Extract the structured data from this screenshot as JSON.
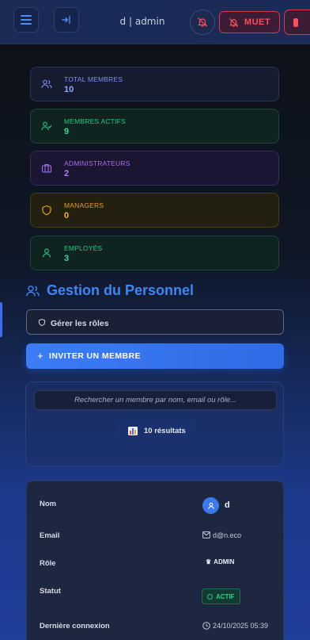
{
  "header": {
    "user_label": "d | admin",
    "mute_label": "MUET"
  },
  "stats": [
    {
      "label": "TOTAL MEMBRES",
      "value": "10",
      "icon": "users-icon",
      "color": "#7b8ef0"
    },
    {
      "label": "MEMBRES ACTIFS",
      "value": "9",
      "icon": "user-check-icon",
      "color": "#27c58c"
    },
    {
      "label": "ADMINISTRATEURS",
      "value": "2",
      "icon": "briefcase-icon",
      "color": "#a56ef0"
    },
    {
      "label": "MANAGERS",
      "value": "0",
      "icon": "shield-icon",
      "color": "#e0a21e"
    },
    {
      "label": "EMPLOYÉS",
      "value": "3",
      "icon": "user-icon",
      "color": "#27c58c"
    }
  ],
  "section": {
    "title": "Gestion du Personnel",
    "roles_button": "Gérer les rôles",
    "invite_button": "INVITER UN MEMBRE"
  },
  "search": {
    "placeholder": "Rechercher un membre par nom, email ou rôle...",
    "value": "",
    "results_label": "10 résultats"
  },
  "member": {
    "fields": {
      "name_label": "Nom",
      "email_label": "Email",
      "role_label": "Rôle",
      "status_label": "Statut",
      "last_login_label": "Dernière connexion"
    },
    "name": "d",
    "email": "d@n.eco",
    "role": "ADMIN",
    "status": "ACTIF",
    "last_login": "24/10/2025 05:39"
  },
  "colors": {
    "accent": "#3b7df5",
    "danger": "#e0344a",
    "success": "#27c58c"
  }
}
